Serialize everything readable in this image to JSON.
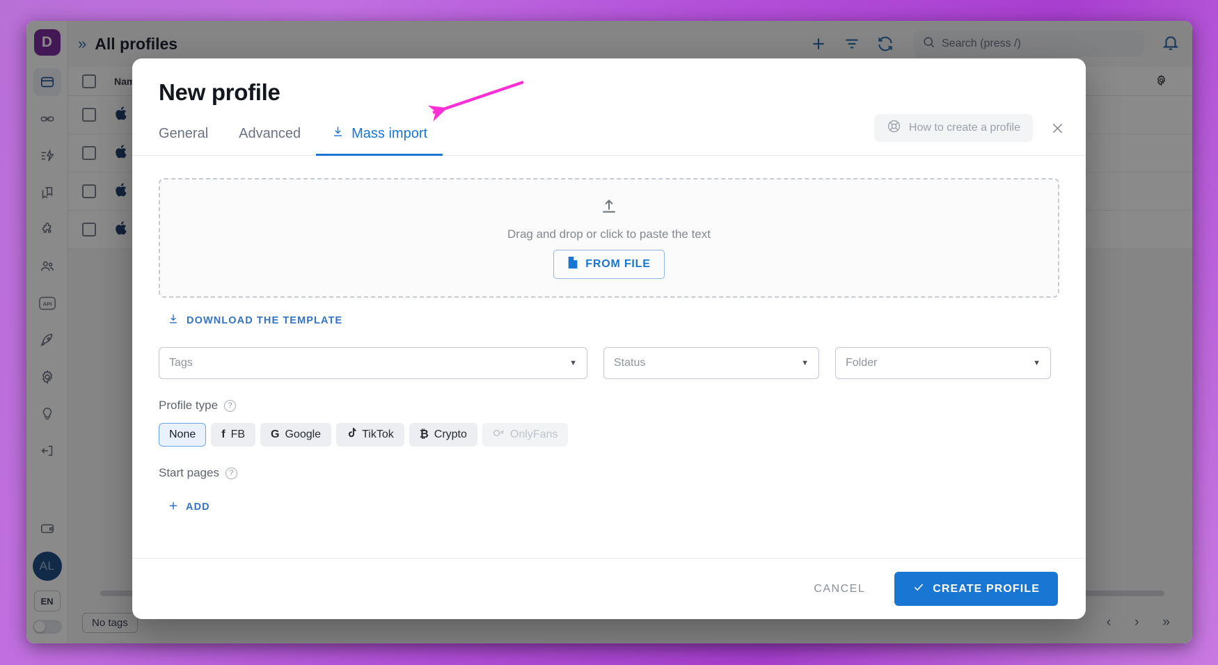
{
  "app": {
    "logo_letter": "D",
    "header": {
      "collapse_icon": "chevrons-right-icon",
      "title": "All profiles",
      "add_icon": "plus-icon",
      "filter_icon": "filter-icon",
      "refresh_icon": "refresh-icon",
      "search_placeholder": "Search (press /)",
      "search_icon": "search-icon",
      "bell_icon": "bell-icon"
    },
    "rail_items": [
      {
        "name": "browser-profiles",
        "icon": "browser-window-icon",
        "active": true
      },
      {
        "name": "proxies",
        "icon": "link-icon",
        "active": false
      },
      {
        "name": "automation",
        "icon": "automation-icon",
        "active": false
      },
      {
        "name": "bookmarks",
        "icon": "bookmarks-icon",
        "active": false
      },
      {
        "name": "extensions",
        "icon": "puzzle-icon",
        "active": false
      },
      {
        "name": "team",
        "icon": "users-icon",
        "active": false
      },
      {
        "name": "api",
        "icon": "api-icon",
        "active": false
      },
      {
        "name": "quick-start",
        "icon": "rocket-icon",
        "active": false
      },
      {
        "name": "settings",
        "icon": "gear-icon",
        "active": false
      },
      {
        "name": "tips",
        "icon": "bulb-icon",
        "active": false
      },
      {
        "name": "logout",
        "icon": "logout-icon",
        "active": false
      },
      {
        "name": "wallet",
        "icon": "wallet-icon",
        "active": false
      }
    ],
    "avatar_initials": "AL",
    "language": "EN",
    "table": {
      "columns": [
        "Name"
      ],
      "row_count": 4,
      "settings_icon": "gear-icon"
    },
    "bottom": {
      "tags_filter": "No tags",
      "prev_icon": "chevron-left-icon",
      "next_icon": "chevron-right-icon",
      "last_icon": "chevrons-right-icon"
    }
  },
  "modal": {
    "title": "New profile",
    "how_to_label": "How to create a profile",
    "how_to_icon": "lifebuoy-icon",
    "close_icon": "close-icon",
    "tabs": [
      {
        "label": "General",
        "active": false,
        "icon": null
      },
      {
        "label": "Advanced",
        "active": false,
        "icon": null
      },
      {
        "label": "Mass import",
        "active": true,
        "icon": "download-icon"
      }
    ],
    "dropzone": {
      "upload_icon": "upload-icon",
      "text": "Drag and drop or click to paste the text",
      "from_file_label": "FROM FILE",
      "from_file_icon": "file-icon"
    },
    "download_template": {
      "label": "DOWNLOAD THE TEMPLATE",
      "icon": "download-icon"
    },
    "selects": [
      {
        "name": "tags",
        "placeholder": "Tags",
        "value": ""
      },
      {
        "name": "status",
        "placeholder": "Status",
        "value": ""
      },
      {
        "name": "folder",
        "placeholder": "Folder",
        "value": ""
      }
    ],
    "profile_type": {
      "label": "Profile type",
      "help_icon": "question-mark-icon",
      "options": [
        {
          "label": "None",
          "icon": null,
          "selected": true,
          "disabled": false
        },
        {
          "label": "FB",
          "icon": "facebook-icon",
          "selected": false,
          "disabled": false
        },
        {
          "label": "Google",
          "icon": "google-icon",
          "selected": false,
          "disabled": false
        },
        {
          "label": "TikTok",
          "icon": "tiktok-icon",
          "selected": false,
          "disabled": false
        },
        {
          "label": "Crypto",
          "icon": "bitcoin-icon",
          "selected": false,
          "disabled": false
        },
        {
          "label": "OnlyFans",
          "icon": "onlyfans-icon",
          "selected": false,
          "disabled": true
        }
      ]
    },
    "start_pages": {
      "label": "Start pages",
      "help_icon": "question-mark-icon",
      "add_label": "ADD",
      "add_icon": "plus-icon"
    },
    "footer": {
      "cancel_label": "CANCEL",
      "create_label": "CREATE PROFILE",
      "create_icon": "check-icon"
    }
  },
  "annotation": {
    "arrow_color": "#ff2fd6",
    "points_to": "Mass import"
  },
  "colors": {
    "accent": "#1976d2",
    "link": "#3273c8",
    "brand_purple": "#7b2f9e",
    "page_bg": "#b24fd8",
    "annotation": "#ff2fd6"
  }
}
